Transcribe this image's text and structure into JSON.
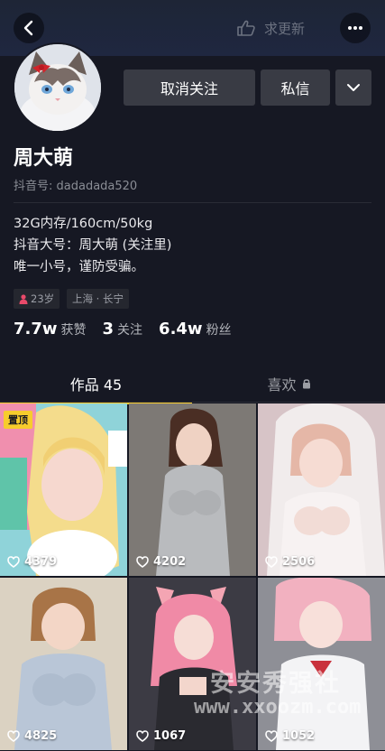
{
  "header": {
    "update_label": "求更新"
  },
  "actions": {
    "unfollow_label": "取消关注",
    "message_label": "私信"
  },
  "profile": {
    "name": "周大萌",
    "douyin_id": "抖音号: dadadada520",
    "bio": [
      "32G内存/160cm/50kg",
      "抖音大号：周大萌 (关注里)",
      "唯一小号，谨防受骗。"
    ],
    "age": "23岁",
    "location": "上海 · 长宁"
  },
  "stats": [
    {
      "value": "7.7w",
      "label": "获赞"
    },
    {
      "value": "3",
      "label": "关注"
    },
    {
      "value": "6.4w",
      "label": "粉丝"
    }
  ],
  "tabs": {
    "works": "作品 45",
    "likes": "喜欢"
  },
  "videos": [
    {
      "likes": "4379",
      "pinned": "置顶"
    },
    {
      "likes": "4202"
    },
    {
      "likes": "2506"
    },
    {
      "likes": "4825"
    },
    {
      "likes": "1067"
    },
    {
      "likes": "1052"
    }
  ],
  "watermark": {
    "cn": "安安秀强社",
    "url": "www.xxoozm.com"
  },
  "colors": {
    "background": "#161823",
    "accent": "#f7cc2c",
    "button": "#393b44",
    "female": "#e94a6a"
  }
}
